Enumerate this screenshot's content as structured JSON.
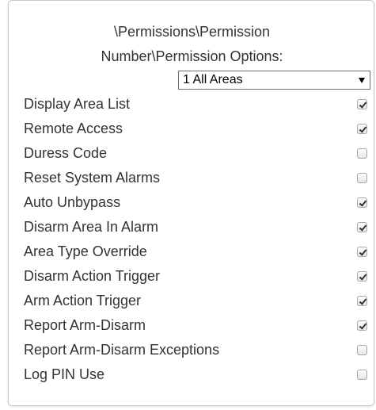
{
  "header": {
    "line1": "\\Permissions\\Permission",
    "line2": "Number\\Permission Options:"
  },
  "area_select": {
    "selected": "1 All Areas"
  },
  "options": [
    {
      "label": "Display Area List",
      "checked": true
    },
    {
      "label": "Remote Access",
      "checked": true
    },
    {
      "label": "Duress Code",
      "checked": false
    },
    {
      "label": "Reset System Alarms",
      "checked": false
    },
    {
      "label": "Auto Unbypass",
      "checked": true
    },
    {
      "label": "Disarm Area In Alarm",
      "checked": true
    },
    {
      "label": "Area Type Override",
      "checked": true
    },
    {
      "label": "Disarm Action Trigger",
      "checked": true
    },
    {
      "label": "Arm Action Trigger",
      "checked": true
    },
    {
      "label": "Report Arm-Disarm",
      "checked": true
    },
    {
      "label": "Report Arm-Disarm Exceptions",
      "checked": false
    },
    {
      "label": "Log PIN Use",
      "checked": false
    }
  ]
}
